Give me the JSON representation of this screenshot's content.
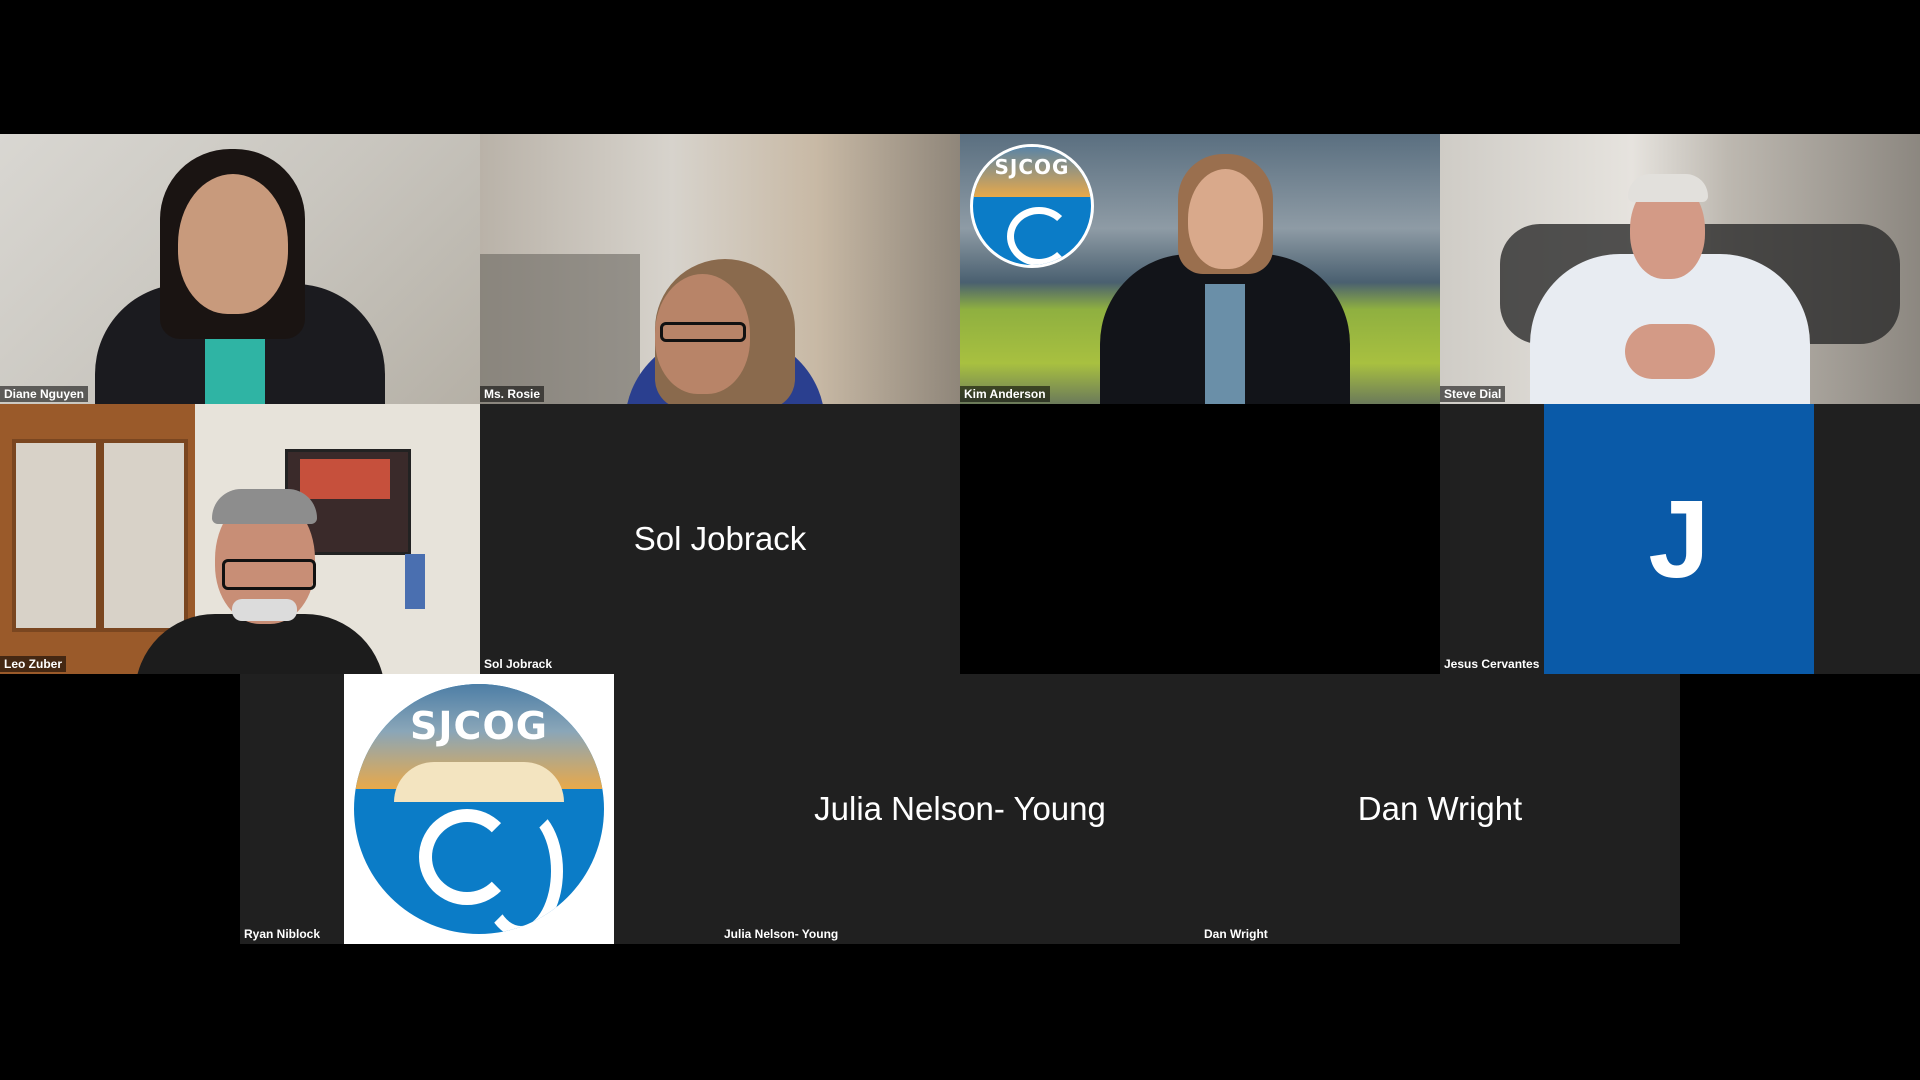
{
  "participants": [
    {
      "name": "Diane Nguyen",
      "type": "video"
    },
    {
      "name": "Ms. Rosie",
      "type": "video"
    },
    {
      "name": "Kim Anderson",
      "type": "video"
    },
    {
      "name": "Steve Dial",
      "type": "video"
    },
    {
      "name": "Leo Zuber",
      "type": "video"
    },
    {
      "name": "Sol Jobrack",
      "type": "name-only",
      "display_name": "Sol Jobrack"
    },
    {
      "name": "",
      "type": "blank"
    },
    {
      "name": "Jesus Cervantes",
      "type": "avatar",
      "avatar_letter": "J",
      "avatar_color": "#0a5aa8"
    },
    {
      "name": "Ryan Niblock",
      "type": "logo",
      "logo_text": "SJCOG"
    },
    {
      "name": "Julia Nelson- Young",
      "type": "name-only",
      "display_name": "Julia Nelson- Young"
    },
    {
      "name": "Dan Wright",
      "type": "name-only",
      "display_name": "Dan Wright"
    }
  ],
  "background_logo_text": "SJCOG",
  "colors": {
    "tile_dark": "#202020",
    "logo_blue": "#0b7cc7",
    "logo_orange": "#e8a94a",
    "avatar_blue": "#0a5aa8"
  }
}
